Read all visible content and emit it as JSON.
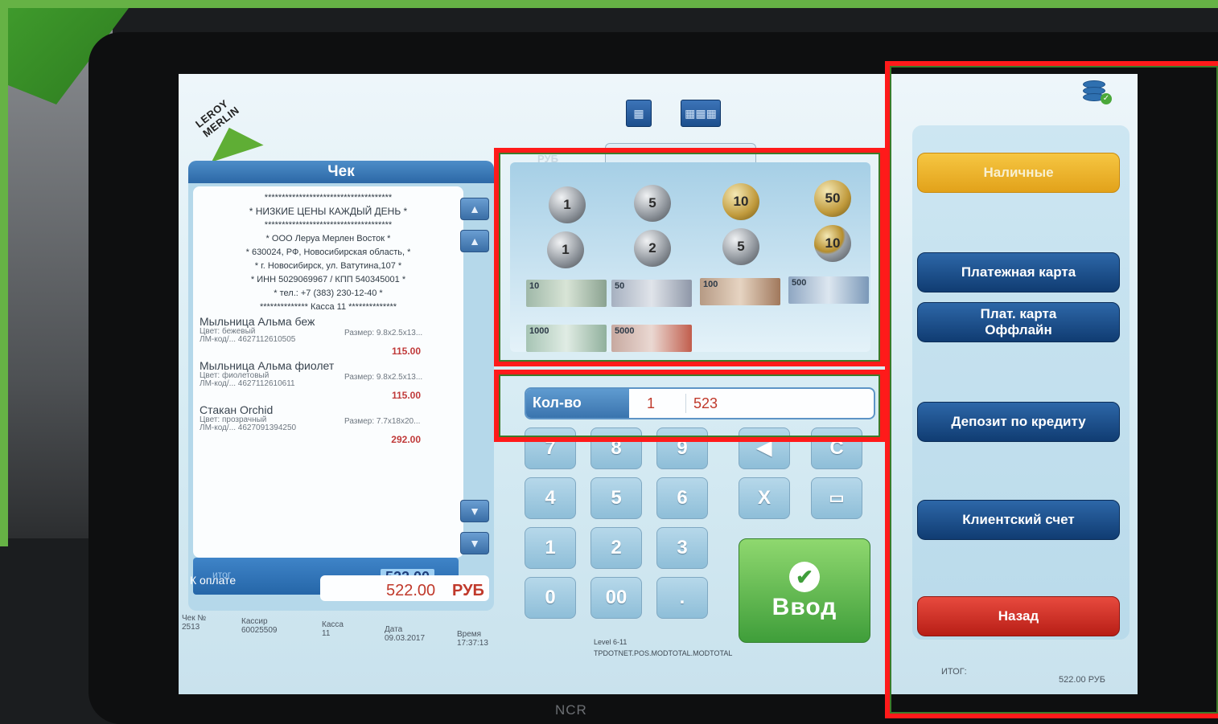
{
  "receipt": {
    "title": "Чек",
    "header_lines": [
      "*************************************",
      "*   НИЗКИЕ ЦЕНЫ КАЖДЫЙ ДЕНЬ   *",
      "*************************************",
      "*   ООО Леруа Мерлен Восток   *",
      "* 630024, РФ, Новосибирская область, *",
      "*  г. Новосибирск, ул. Ватутина,107  *",
      "*  ИНН 5029069967 / КПП 540345001  *",
      "*     тел.: +7 (383) 230-12-40     *",
      "************** Касса 11 **************"
    ],
    "items": [
      {
        "name": "Мыльница Альма беж",
        "color": "Цвет:  бежевый",
        "sku": "ЛМ-код/...  4627112610505",
        "size": "Размер: 9.8x2.5x13...",
        "price": "115.00"
      },
      {
        "name": "Мыльница Альма фиолет",
        "color": "Цвет:  фиолетовый",
        "sku": "ЛМ-код/...  4627112610611",
        "size": "Размер: 9.8x2.5x13...",
        "price": "115.00"
      },
      {
        "name": "Стакан Orchid",
        "color": "Цвет:  прозрачный",
        "sku": "ЛМ-код/...  4627091394250",
        "size": "Размер: 7.7x18x20...",
        "price": "292.00"
      }
    ],
    "total_label": "итог",
    "total_value": "522.00",
    "to_pay_label": "К оплате",
    "to_pay_value": "522.00",
    "currency": "РУБ"
  },
  "status": {
    "check_no_label": "Чек №",
    "check_no": "2513",
    "cashier_label": "Кассир",
    "cashier": "60025509",
    "register_label": "Касса",
    "register": "11",
    "date_label": "Дата",
    "date": "09.03.2017",
    "time_label": "Время",
    "time": "17:37:13",
    "level": "Level 6-11",
    "module": "TPDOTNET.POS.MODTOTAL.MODTOTAL"
  },
  "denominations": {
    "currency_label": "РУБ",
    "coins": [
      "1",
      "5",
      "10",
      "50",
      "1",
      "2",
      "5",
      "10"
    ],
    "bills": [
      "10",
      "50",
      "100",
      "500",
      "1000",
      "5000"
    ]
  },
  "quantity": {
    "label": "Кол-во",
    "count": "1",
    "value": "523"
  },
  "keypad": {
    "keys": [
      "7",
      "8",
      "9",
      "4",
      "5",
      "6",
      "1",
      "2",
      "3",
      "0",
      "00",
      "."
    ],
    "back_label": "◀",
    "clear_label": "C",
    "multiply_label": "X",
    "enter_label": "Ввод"
  },
  "payment_methods": {
    "cash": "Наличные",
    "card": "Платежная карта",
    "card_offline_line1": "Плат. карта",
    "card_offline_line2": "Оффлайн",
    "credit_deposit": "Депозит по кредиту",
    "client_account": "Клиентский счет",
    "back": "Назад"
  },
  "summary": {
    "itog_label": "ИТОГ:",
    "itog_value": "522.00 РУБ"
  },
  "brand": {
    "logo_text": "LEROY MERLIN",
    "device": "NCR"
  },
  "colors": {
    "accent_blue": "#2d67a8",
    "cash_yellow": "#f6c642",
    "back_red": "#e84a3e",
    "enter_green": "#3f9e3a",
    "annotation_red": "#ff1a1a"
  }
}
